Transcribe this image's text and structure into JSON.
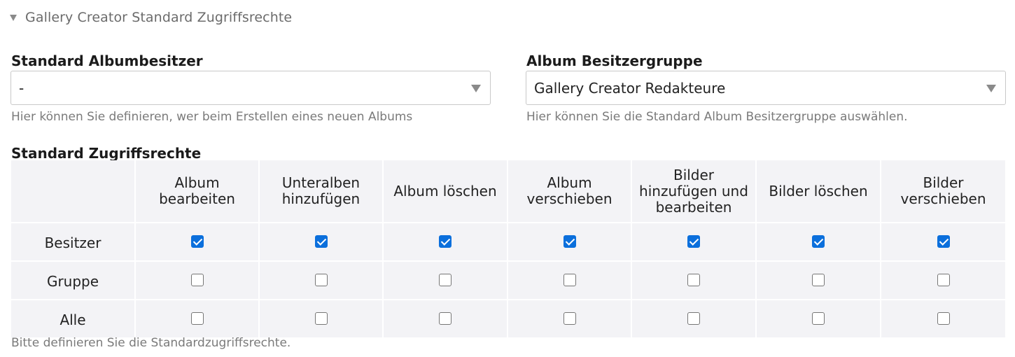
{
  "legend": {
    "title": "Gallery Creator Standard Zugriffsrechte"
  },
  "owner": {
    "label": "Standard Albumbesitzer",
    "value": "-",
    "help": "Hier können Sie definieren, wer beim Erstellen eines neuen Albums"
  },
  "group": {
    "label": "Album Besitzergruppe",
    "value": "Gallery Creator Redakteure",
    "help": "Hier können Sie die Standard Album Besitzergruppe auswählen."
  },
  "permissions": {
    "title": "Standard Zugriffsrechte",
    "columns": [
      "Album bearbeiten",
      "Unteralben hinzufügen",
      "Album löschen",
      "Album verschieben",
      "Bilder hinzufügen und bearbeiten",
      "Bilder löschen",
      "Bilder verschieben"
    ],
    "rows": [
      {
        "label": "Besitzer",
        "checked": [
          true,
          true,
          true,
          true,
          true,
          true,
          true
        ]
      },
      {
        "label": "Gruppe",
        "checked": [
          false,
          false,
          false,
          false,
          false,
          false,
          false
        ]
      },
      {
        "label": "Alle",
        "checked": [
          false,
          false,
          false,
          false,
          false,
          false,
          false
        ]
      }
    ],
    "help": "Bitte definieren Sie die Standardzugriffsrechte."
  },
  "colors": {
    "accent": "#0b6fdc",
    "cell_bg": "#f3f3f6",
    "help_text": "#7a7a7a"
  },
  "icons": {
    "legend": "triangle-down-icon",
    "select": "chevron-down-icon",
    "checkbox": "checkbox-icon"
  }
}
